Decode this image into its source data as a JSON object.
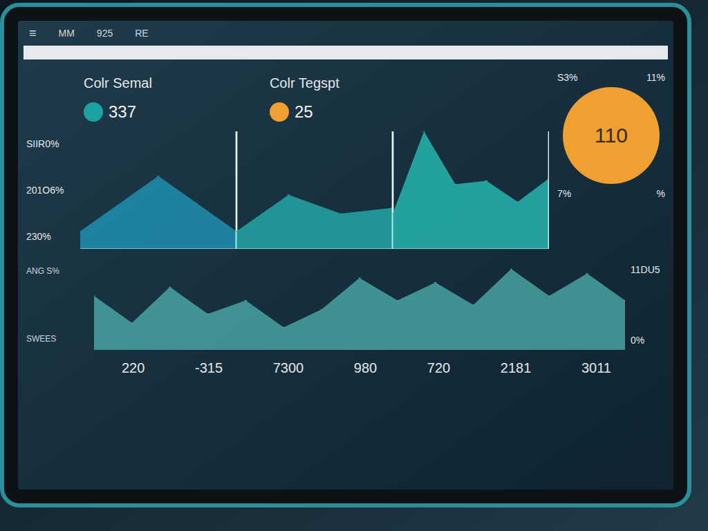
{
  "nav": {
    "menu": "≡",
    "items": [
      "MM",
      "925",
      "RE"
    ]
  },
  "cards": [
    {
      "title": "Colr Semal",
      "value": "337",
      "color": "#1ba3a3"
    },
    {
      "title": "Colr Tegspt",
      "value": "25",
      "color": "#f0a030"
    }
  ],
  "area_chart": {
    "y_ticks": [
      "SIIR0%",
      "201O6%",
      "230%"
    ],
    "series": [
      {
        "values": [
          15,
          62,
          15
        ],
        "color": "#1f8fb0"
      },
      {
        "values": [
          15,
          46,
          30,
          35
        ],
        "color": "#22a6a6"
      },
      {
        "values": [
          30,
          100,
          55,
          58,
          40,
          60
        ],
        "color": "#26b5b0"
      }
    ]
  },
  "gauge": {
    "value": "110",
    "top_labels": [
      "S3%",
      "11%"
    ],
    "bottom_labels": [
      "7%",
      "%"
    ],
    "color": "#f0a030"
  },
  "wave_chart": {
    "labels": [
      "ANG S%",
      "SWEES"
    ],
    "right_labels": [
      "11DU5",
      "0%"
    ],
    "values": [
      60,
      30,
      70,
      40,
      55,
      25,
      45,
      80,
      55,
      75,
      50,
      90,
      60,
      85,
      55
    ],
    "color": "#4fb3b0"
  },
  "x_ticks": [
    "220",
    "-315",
    "7300",
    "980",
    "720",
    "2181",
    "3011"
  ]
}
